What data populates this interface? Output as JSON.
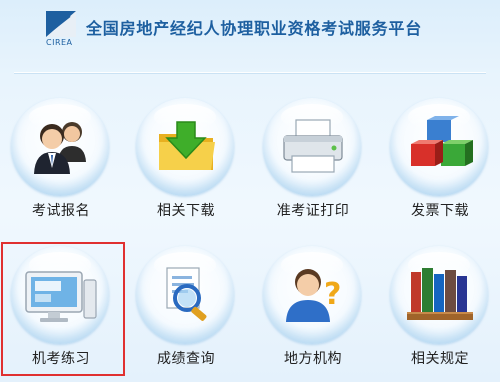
{
  "header": {
    "logo_text": "CIREA",
    "title": "全国房地产经纪人协理职业资格考试服务平台"
  },
  "tiles": [
    {
      "label": "考试报名",
      "icon": "users-icon"
    },
    {
      "label": "相关下载",
      "icon": "download-folder-icon"
    },
    {
      "label": "准考证打印",
      "icon": "printer-icon"
    },
    {
      "label": "发票下载",
      "icon": "cubes-icon"
    },
    {
      "label": "机考练习",
      "icon": "computer-icon",
      "highlighted": true
    },
    {
      "label": "成绩查询",
      "icon": "document-search-icon"
    },
    {
      "label": "地方机构",
      "icon": "user-question-icon"
    },
    {
      "label": "相关规定",
      "icon": "books-icon"
    }
  ],
  "colors": {
    "brand": "#1d5fa0",
    "highlight_border": "#e03030"
  }
}
